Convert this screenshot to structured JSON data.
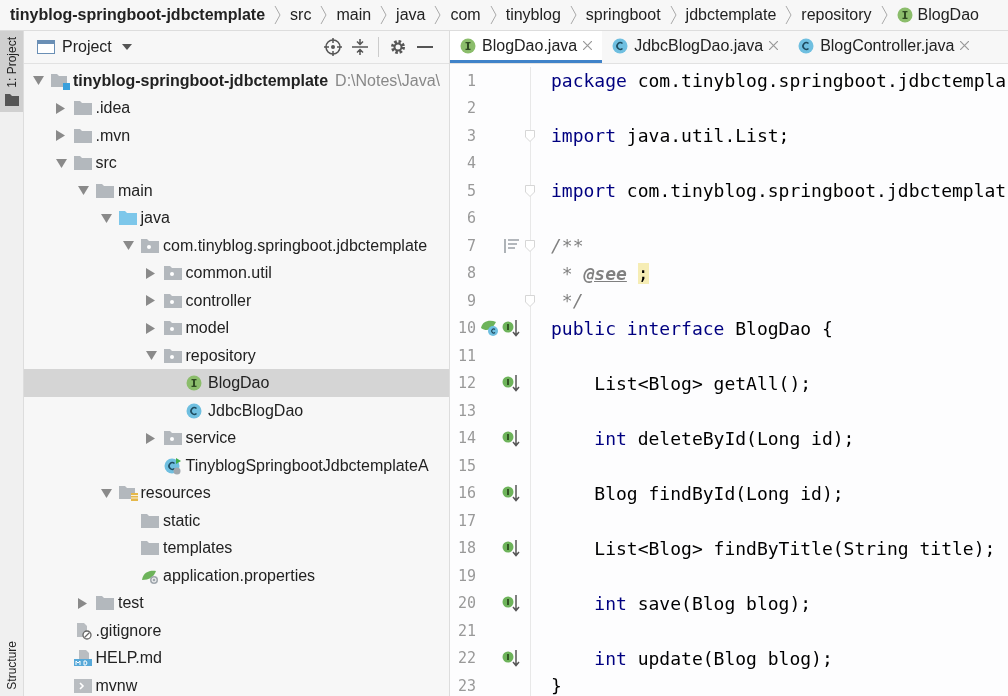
{
  "breadcrumbs": [
    {
      "label": "tinyblog-springboot-jdbctemplate",
      "kind": "project"
    },
    {
      "label": "src",
      "kind": "folder"
    },
    {
      "label": "main",
      "kind": "folder"
    },
    {
      "label": "java",
      "kind": "folder"
    },
    {
      "label": "com",
      "kind": "folder"
    },
    {
      "label": "tinyblog",
      "kind": "folder"
    },
    {
      "label": "springboot",
      "kind": "folder"
    },
    {
      "label": "jdbctemplate",
      "kind": "folder"
    },
    {
      "label": "repository",
      "kind": "folder"
    },
    {
      "label": "BlogDao",
      "kind": "interface"
    }
  ],
  "side_strip": {
    "top_tab": {
      "label": "1: Project",
      "selected": true
    },
    "bottom_tab": {
      "label": "Structure",
      "selected": false
    }
  },
  "project": {
    "title": "Project",
    "tree": [
      {
        "label": "tinyblog-springboot-jdbctemplate",
        "hint": "D:\\Notes\\Java\\",
        "kind": "module",
        "expanded": true,
        "selected": false,
        "children": [
          {
            "label": ".idea",
            "kind": "folder",
            "expanded": false,
            "selected": false
          },
          {
            "label": ".mvn",
            "kind": "folder",
            "expanded": false,
            "selected": false
          },
          {
            "label": "src",
            "kind": "folder",
            "expanded": true,
            "selected": false,
            "children": [
              {
                "label": "main",
                "kind": "folder",
                "expanded": true,
                "selected": false,
                "children": [
                  {
                    "label": "java",
                    "kind": "source",
                    "expanded": true,
                    "selected": false,
                    "children": [
                      {
                        "label": "com.tinyblog.springboot.jdbctemplate",
                        "kind": "package",
                        "expanded": true,
                        "selected": false,
                        "children": [
                          {
                            "label": "common.util",
                            "kind": "package",
                            "expanded": false,
                            "selected": false
                          },
                          {
                            "label": "controller",
                            "kind": "package",
                            "expanded": false,
                            "selected": false
                          },
                          {
                            "label": "model",
                            "kind": "package",
                            "expanded": false,
                            "selected": false
                          },
                          {
                            "label": "repository",
                            "kind": "package",
                            "expanded": true,
                            "selected": false,
                            "children": [
                              {
                                "label": "BlogDao",
                                "kind": "interface",
                                "selected": true
                              },
                              {
                                "label": "JdbcBlogDao",
                                "kind": "class",
                                "selected": false
                              }
                            ]
                          },
                          {
                            "label": "service",
                            "kind": "package",
                            "expanded": false,
                            "selected": false
                          },
                          {
                            "label": "TinyblogSpringbootJdbctemplateA",
                            "kind": "spring-class",
                            "selected": false
                          }
                        ]
                      }
                    ]
                  },
                  {
                    "label": "resources",
                    "kind": "resources",
                    "expanded": true,
                    "selected": false,
                    "children": [
                      {
                        "label": "static",
                        "kind": "folder",
                        "selected": false
                      },
                      {
                        "label": "templates",
                        "kind": "folder",
                        "selected": false
                      },
                      {
                        "label": "application.properties",
                        "kind": "properties",
                        "selected": false
                      }
                    ]
                  }
                ]
              },
              {
                "label": "test",
                "kind": "folder",
                "expanded": false,
                "selected": false
              }
            ]
          },
          {
            "label": ".gitignore",
            "kind": "ignore",
            "selected": false
          },
          {
            "label": "HELP.md",
            "kind": "markdown",
            "selected": false
          },
          {
            "label": "mvnw",
            "kind": "script",
            "selected": false
          }
        ]
      }
    ]
  },
  "editor": {
    "tabs": [
      {
        "label": "BlogDao.java",
        "kind": "interface",
        "selected": true
      },
      {
        "label": "JdbcBlogDao.java",
        "kind": "class",
        "selected": false
      },
      {
        "label": "BlogController.java",
        "kind": "class",
        "selected": false
      }
    ],
    "lines": [
      {
        "number": "1",
        "fold": false,
        "tokens": [
          {
            "kind": "keyword",
            "text": "package"
          },
          {
            "kind": "plain",
            "text": " com.tinyblog.springboot.jdbctempla"
          }
        ]
      },
      {
        "number": "2",
        "fold": false
      },
      {
        "number": "3",
        "fold": true,
        "tokens": [
          {
            "kind": "keyword",
            "text": "import"
          },
          {
            "kind": "plain",
            "text": " java.util.List;"
          }
        ]
      },
      {
        "number": "4",
        "fold": false
      },
      {
        "number": "5",
        "fold": true,
        "tokens": [
          {
            "kind": "keyword",
            "text": "import"
          },
          {
            "kind": "plain",
            "text": " com.tinyblog.springboot.jdbctemplat"
          }
        ]
      },
      {
        "number": "6",
        "fold": false
      },
      {
        "number": "7",
        "markers": [
          {
            "kind": "doc"
          }
        ],
        "fold": true,
        "tokens": [
          {
            "kind": "comment",
            "text": "/**"
          }
        ]
      },
      {
        "number": "8",
        "fold": false,
        "tokens": [
          {
            "kind": "comment",
            "text": " * "
          },
          {
            "kind": "doctag",
            "text": "@see"
          },
          {
            "kind": "highlight",
            "text": ";"
          }
        ]
      },
      {
        "number": "9",
        "fold": true,
        "tokens": [
          {
            "kind": "comment",
            "text": " */"
          }
        ]
      },
      {
        "number": "10",
        "markers": [
          {
            "kind": "implemented"
          },
          {
            "kind": "implementing"
          }
        ],
        "fold": false,
        "tokens": [
          {
            "kind": "keyword",
            "text": "public interface"
          },
          {
            "kind": "plain",
            "text": " BlogDao {"
          }
        ]
      },
      {
        "number": "11",
        "fold": false
      },
      {
        "number": "12",
        "markers": [
          {
            "kind": "implementing"
          }
        ],
        "fold": false,
        "tokens": [
          {
            "kind": "plain",
            "text": "    List<Blog> getAll();"
          }
        ]
      },
      {
        "number": "13",
        "fold": false
      },
      {
        "number": "14",
        "markers": [
          {
            "kind": "implementing"
          }
        ],
        "fold": false,
        "tokens": [
          {
            "kind": "keyword",
            "text": "    int"
          },
          {
            "kind": "plain",
            "text": " deleteById(Long id);"
          }
        ]
      },
      {
        "number": "15",
        "fold": false
      },
      {
        "number": "16",
        "markers": [
          {
            "kind": "implementing"
          }
        ],
        "fold": false,
        "tokens": [
          {
            "kind": "plain",
            "text": "    Blog findById(Long id);"
          }
        ]
      },
      {
        "number": "17",
        "fold": false
      },
      {
        "number": "18",
        "markers": [
          {
            "kind": "implementing"
          }
        ],
        "fold": false,
        "tokens": [
          {
            "kind": "plain",
            "text": "    List<Blog> findByTitle(String title);"
          }
        ]
      },
      {
        "number": "19",
        "fold": false
      },
      {
        "number": "20",
        "markers": [
          {
            "kind": "implementing"
          }
        ],
        "fold": false,
        "tokens": [
          {
            "kind": "keyword",
            "text": "    int"
          },
          {
            "kind": "plain",
            "text": " save(Blog blog);"
          }
        ]
      },
      {
        "number": "21",
        "fold": false
      },
      {
        "number": "22",
        "markers": [
          {
            "kind": "implementing"
          }
        ],
        "fold": false,
        "tokens": [
          {
            "kind": "keyword",
            "text": "    int"
          },
          {
            "kind": "plain",
            "text": " update(Blog blog);"
          }
        ]
      },
      {
        "number": "23",
        "fold": false,
        "tokens": [
          {
            "kind": "plain",
            "text": "}"
          }
        ]
      }
    ]
  }
}
